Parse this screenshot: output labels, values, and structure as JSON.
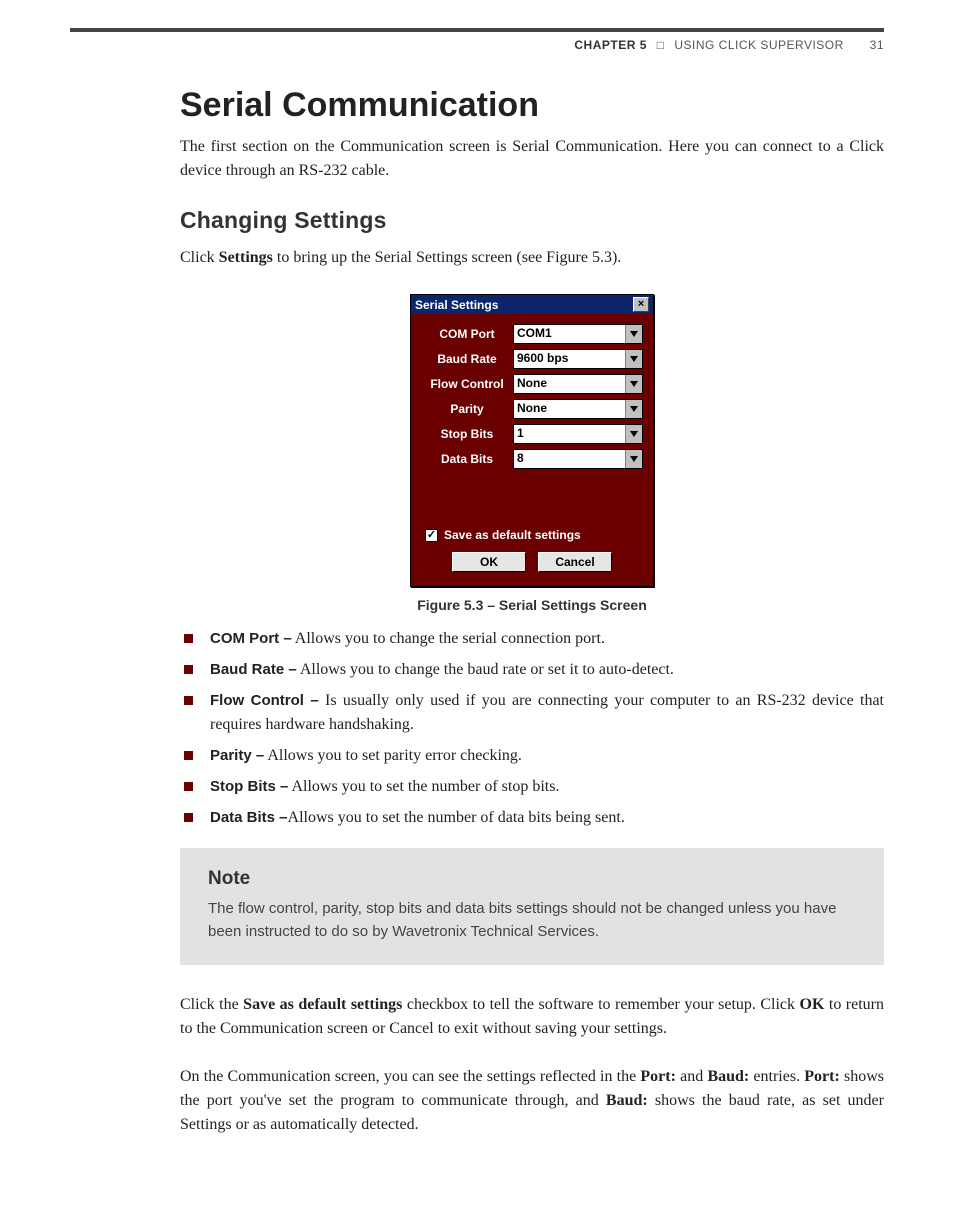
{
  "header": {
    "chapter_label": "CHAPTER 5",
    "square": "□",
    "title": "USING CLICK SUPERVISOR",
    "page": "31"
  },
  "h1": "Serial Communication",
  "intro": "The first section on the Communication screen is Serial Communication. Here you can connect to a Click device through an RS-232 cable.",
  "h2": "Changing Settings",
  "click_line_a": "Click ",
  "click_line_b": "Settings",
  "click_line_c": " to bring up the Serial Settings screen (see Figure 5.3).",
  "dialog": {
    "title": "Serial Settings",
    "fields": [
      {
        "label": "COM Port",
        "value": "COM1"
      },
      {
        "label": "Baud Rate",
        "value": "9600 bps"
      },
      {
        "label": "Flow Control",
        "value": "None"
      },
      {
        "label": "Parity",
        "value": "None"
      },
      {
        "label": "Stop Bits",
        "value": "1"
      },
      {
        "label": "Data Bits",
        "value": "8"
      }
    ],
    "checkbox_label": "Save as default settings",
    "ok": "OK",
    "cancel": "Cancel"
  },
  "caption": "Figure 5.3 – Serial Settings Screen",
  "list": [
    {
      "term": "COM Port –",
      "desc": " Allows you to change the serial connection port."
    },
    {
      "term": "Baud Rate –",
      "desc": " Allows you to change the baud rate or set it to auto-detect."
    },
    {
      "term": "Flow Control –",
      "desc": " Is usually only used if you are connecting your computer to an RS-232 device that requires hardware handshaking."
    },
    {
      "term": "Parity –",
      "desc": " Allows you to set parity error checking."
    },
    {
      "term": "Stop Bits –",
      "desc": " Allows you to set the number of stop bits."
    },
    {
      "term": "Data Bits –",
      "desc": "Allows you to set the number of data bits being sent."
    }
  ],
  "note": {
    "heading": "Note",
    "body": "The flow control, parity, stop bits and data bits settings should not be changed unless you have been instructed to do so by Wavetronix Technical Services."
  },
  "para2_a": "Click the ",
  "para2_b": "Save as default settings",
  "para2_c": " checkbox to tell the software to remember your setup. Click ",
  "para2_d": "OK",
  "para2_e": " to return to the Communication screen or Cancel to exit without saving your settings.",
  "para3_a": "On the Communication screen, you can see the settings reflected in the ",
  "para3_b": "Port:",
  "para3_c": " and ",
  "para3_d": "Baud:",
  "para3_e": " entries. ",
  "para3_f": "Port:",
  "para3_g": " shows the port you've set the program to communicate through, and ",
  "para3_h": "Baud:",
  "para3_i": " shows the baud rate, as set under Settings or as automatically detected."
}
